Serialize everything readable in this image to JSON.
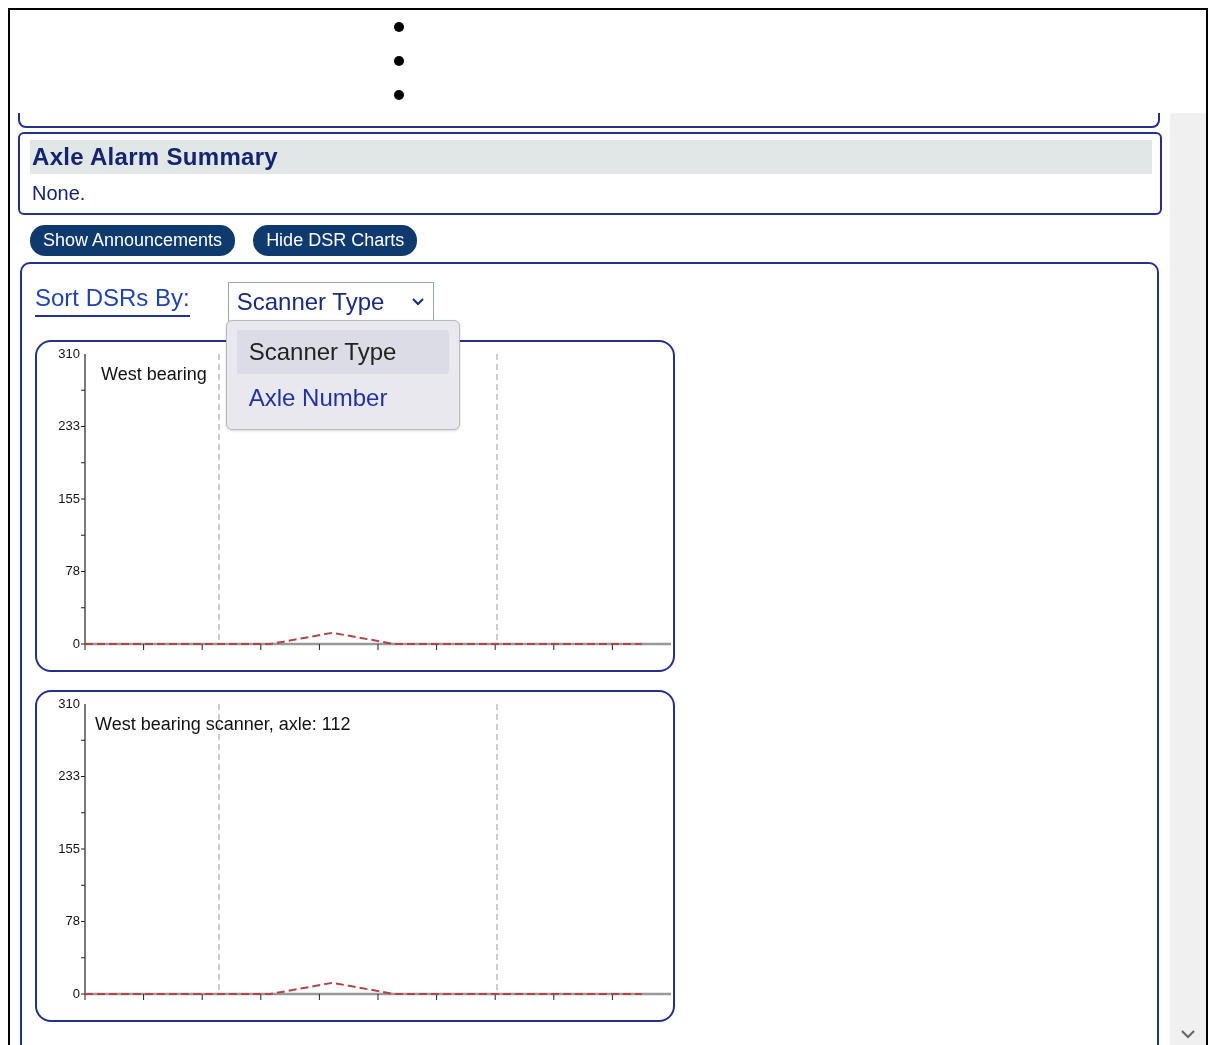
{
  "alarm_summary": {
    "title": "Axle Alarm Summary",
    "text": "None."
  },
  "buttons": [
    "Show Announcements",
    "Hide DSR Charts"
  ],
  "sort": {
    "label": "Sort DSRs By:",
    "value": "Scanner Type",
    "expanded": true,
    "options": [
      {
        "label": "Scanner Type",
        "selected": true
      },
      {
        "label": "Axle Number",
        "selected": false
      }
    ]
  },
  "charts": [
    {
      "title": "West bearing",
      "chart_data": {
        "type": "line",
        "ylim": [
          0,
          310
        ],
        "yticks": [
          0,
          78,
          155,
          233,
          310
        ],
        "series": [
          {
            "color": "#b04545",
            "line_style": "dashed",
            "values": [
              0,
              0,
              0,
              0,
              12,
              0,
              0,
              0,
              0,
              0
            ]
          }
        ]
      }
    },
    {
      "title": "West bearing scanner, axle: 112",
      "chart_data": {
        "type": "line",
        "ylim": [
          0,
          310
        ],
        "yticks": [
          0,
          78,
          155,
          233,
          310
        ],
        "series": [
          {
            "color": "#b04545",
            "line_style": "dashed",
            "values": [
              0,
              0,
              0,
              0,
              12,
              0,
              0,
              0,
              0,
              0
            ]
          }
        ]
      }
    }
  ]
}
